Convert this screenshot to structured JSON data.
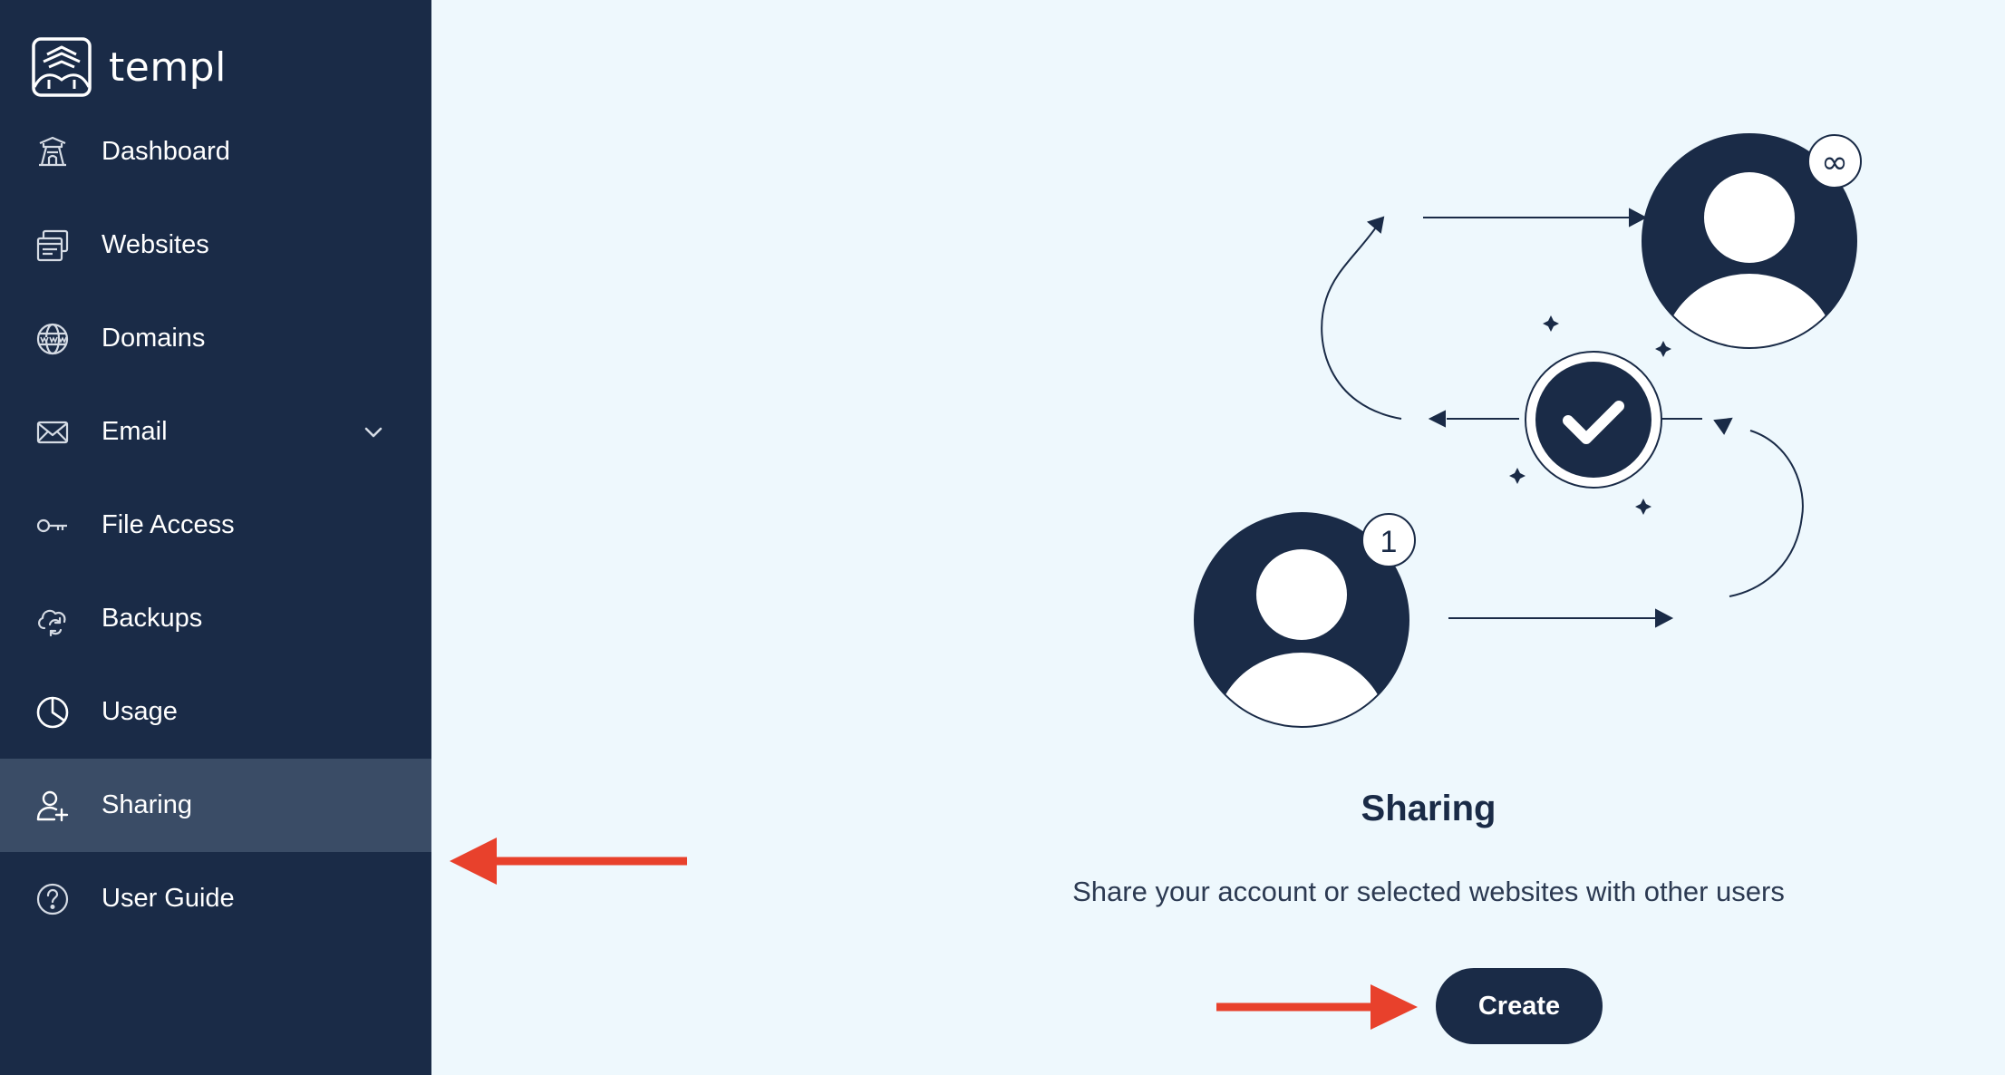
{
  "brand": {
    "name": "templ"
  },
  "sidebar": {
    "items": [
      {
        "label": "Dashboard",
        "icon": "dashboard-icon"
      },
      {
        "label": "Websites",
        "icon": "websites-icon"
      },
      {
        "label": "Domains",
        "icon": "www-globe-icon"
      },
      {
        "label": "Email",
        "icon": "envelope-icon",
        "has_dropdown": true
      },
      {
        "label": "File Access",
        "icon": "key-icon"
      },
      {
        "label": "Backups",
        "icon": "cloud-sync-icon"
      },
      {
        "label": "Usage",
        "icon": "pie-chart-icon"
      },
      {
        "label": "Sharing",
        "icon": "add-user-icon",
        "active": true
      },
      {
        "label": "User Guide",
        "icon": "help-circle-icon"
      }
    ]
  },
  "main": {
    "title": "Sharing",
    "subtitle": "Share your account or selected websites with other users",
    "create_label": "Create",
    "illustration": {
      "badge_top": "∞",
      "badge_bottom": "1"
    }
  },
  "colors": {
    "sidebar_bg": "#1a2b47",
    "sidebar_active": "#3a4c66",
    "main_bg": "#eef8fd",
    "accent_dark": "#1a2b47",
    "annotation_red": "#e8412c"
  }
}
